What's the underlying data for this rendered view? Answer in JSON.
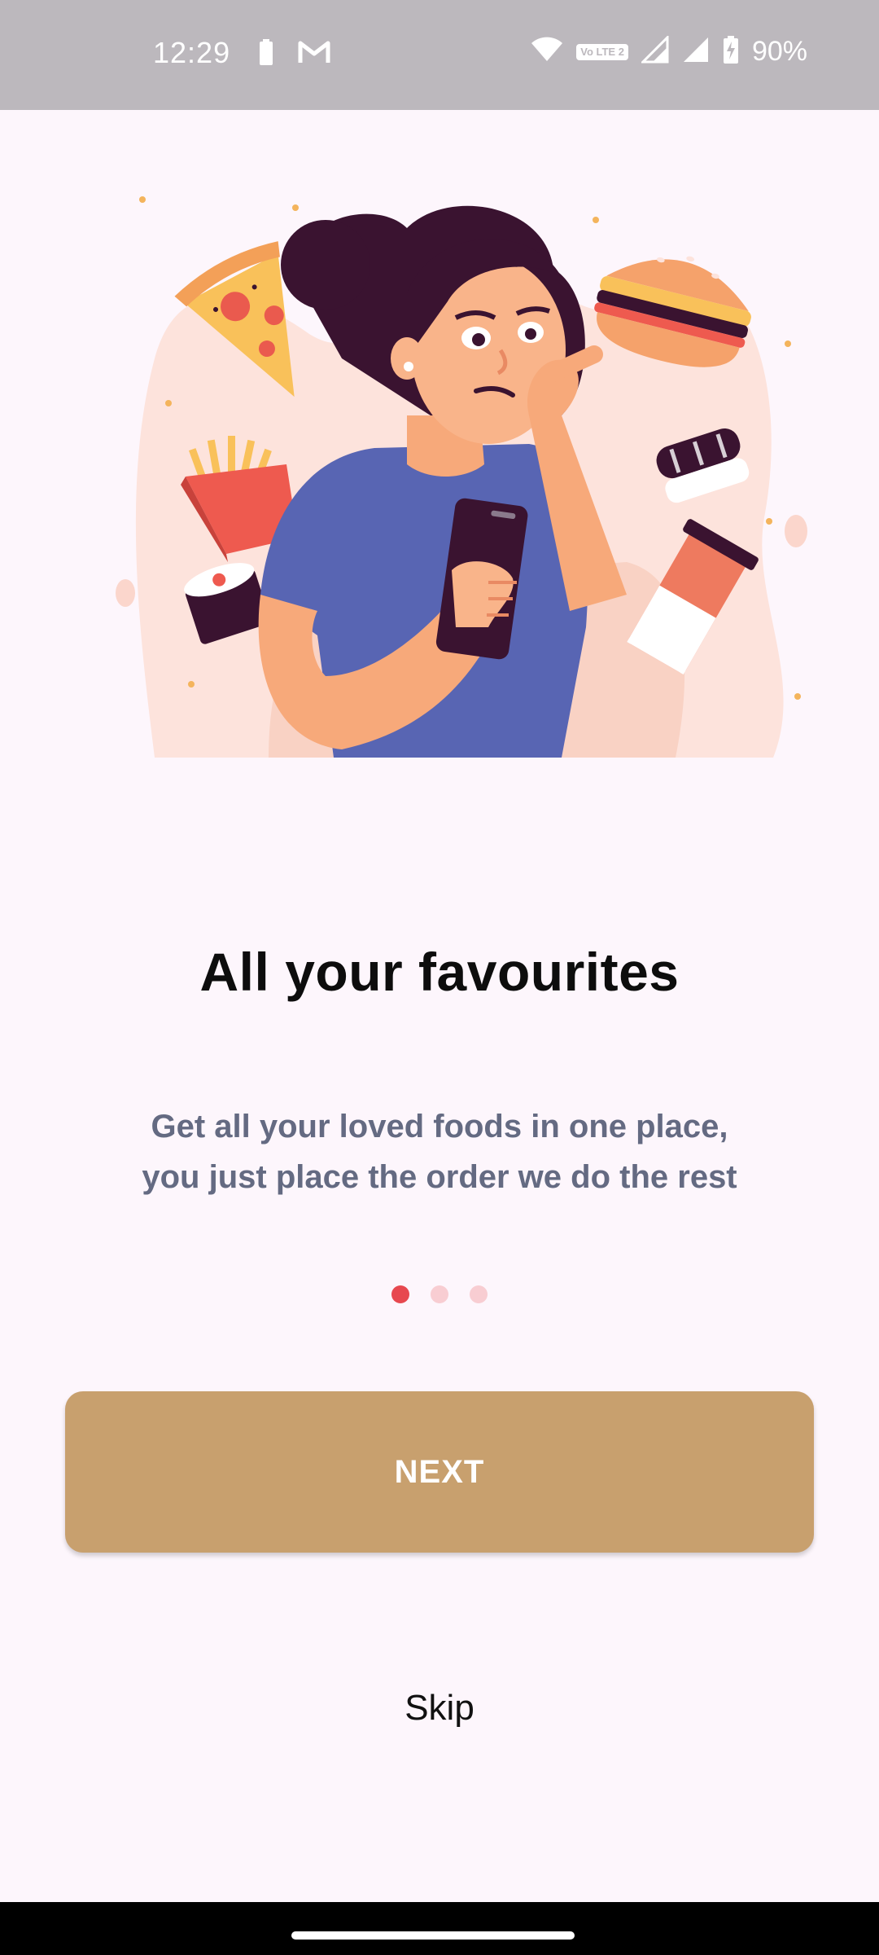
{
  "status_bar": {
    "time": "12:29",
    "left_icons": [
      "battery-saver-icon",
      "gmail-icon"
    ],
    "right_icons": [
      "wifi-icon",
      "volte-icon",
      "signal-icon",
      "signal-icon",
      "charging-battery-icon"
    ],
    "volte_label": "Vo LTE 2",
    "battery_percent": "90%"
  },
  "onboarding": {
    "illustration_icon": "woman-choosing-food-illustration",
    "title": "All your favourites",
    "subtitle_line1": "Get all your loved foods in one place,",
    "subtitle_line2": "you just place the order we do the rest",
    "page_count": 3,
    "active_page": 1
  },
  "actions": {
    "next_label": "NEXT",
    "skip_label": "Skip"
  },
  "colors": {
    "background": "#fdf6fc",
    "accent_button": "#c8a06e",
    "active_dot": "#e7484f",
    "inactive_dot": "#f8cdd2",
    "subtitle_text": "#646a82"
  }
}
